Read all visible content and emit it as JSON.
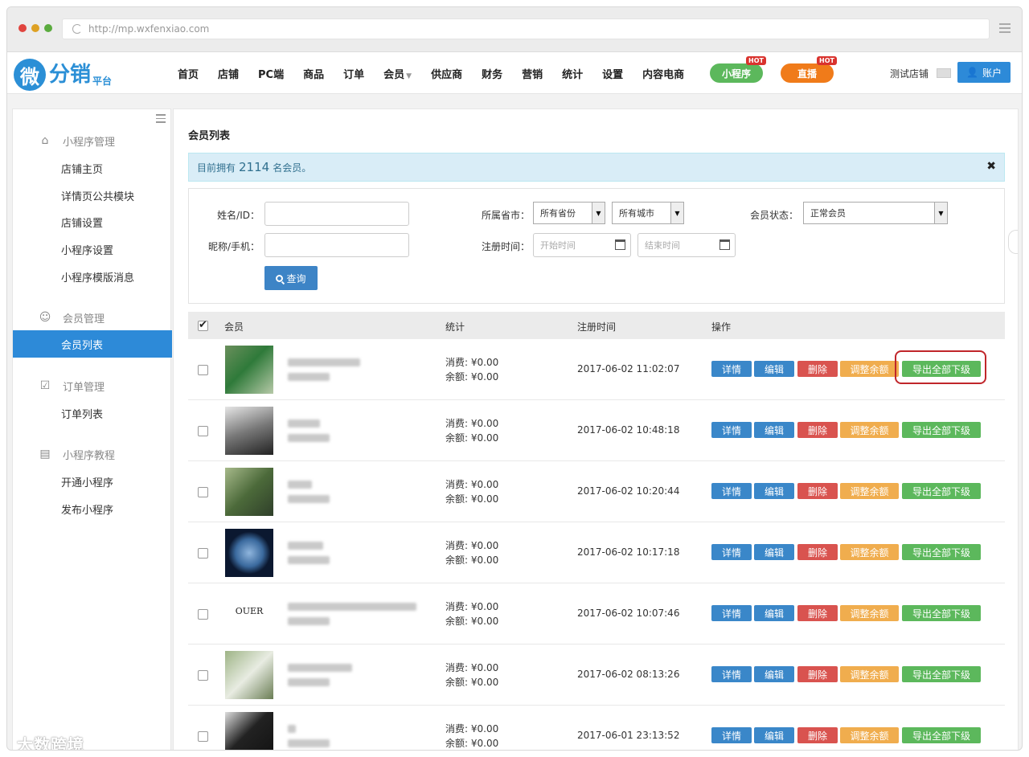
{
  "browser": {
    "url": "http://mp.wxfenxiao.com"
  },
  "brand": {
    "logo_char": "微",
    "logo_text": "分销",
    "logo_sub": "平台"
  },
  "nav": {
    "links": [
      "首页",
      "店铺",
      "PC端",
      "商品",
      "订单",
      "会员",
      "供应商",
      "财务",
      "营销",
      "统计",
      "设置",
      "内容电商"
    ],
    "mini_program": "小程序",
    "live": "直播",
    "hot": "HOT",
    "shop_name": "测试店铺",
    "account": "账户"
  },
  "sidebar": {
    "groups": [
      {
        "title": "小程序管理",
        "icon": "home-icon",
        "items": [
          "店铺主页",
          "详情页公共模块",
          "店铺设置",
          "小程序设置",
          "小程序模版消息"
        ]
      },
      {
        "title": "会员管理",
        "icon": "users-icon",
        "items": [
          "会员列表"
        ]
      },
      {
        "title": "订单管理",
        "icon": "clipboard-icon",
        "items": [
          "订单列表"
        ]
      },
      {
        "title": "小程序教程",
        "icon": "book-icon",
        "items": [
          "开通小程序",
          "发布小程序"
        ]
      }
    ],
    "active": "会员列表"
  },
  "page": {
    "title": "会员列表",
    "notice_prefix": "目前拥有",
    "member_count": "2114",
    "notice_suffix": "名会员。",
    "notice_close": "✖"
  },
  "filters": {
    "name_label": "姓名/ID：",
    "nick_label": "昵称/手机：",
    "region_label": "所属省市：",
    "province": "所有省份",
    "city": "所有城市",
    "reg_label": "注册时间：",
    "start_placeholder": "开始时间",
    "end_placeholder": "结束时间",
    "status_label": "会员状态：",
    "status": "正常会员",
    "query_button": "查询"
  },
  "table": {
    "headers": {
      "member": "会员",
      "stats": "统计",
      "reg_time": "注册时间",
      "actions": "操作"
    },
    "actions": {
      "detail": "详情",
      "edit": "编辑",
      "delete": "删除",
      "adjust": "调整余额",
      "export": "导出全部下级"
    },
    "rows": [
      {
        "consume": "消费: ¥0.00",
        "balance": "余额: ¥0.00",
        "time": "2017-06-02 11:02:07",
        "avatar": "green-dress-photo"
      },
      {
        "consume": "消费: ¥0.00",
        "balance": "余额: ¥0.00",
        "time": "2017-06-02 10:48:18",
        "avatar": "bw-photo"
      },
      {
        "consume": "消费: ¥0.00",
        "balance": "余额: ¥0.00",
        "time": "2017-06-02 10:20:44",
        "avatar": "outdoor-photo"
      },
      {
        "consume": "消费: ¥0.00",
        "balance": "余额: ¥0.00",
        "time": "2017-06-02 10:17:18",
        "avatar": "earth-photo"
      },
      {
        "consume": "消费: ¥0.00",
        "balance": "余额: ¥0.00",
        "time": "2017-06-02 10:07:46",
        "avatar": "ouer-logo",
        "logo_text": "OUER"
      },
      {
        "consume": "消费: ¥0.00",
        "balance": "余额: ¥0.00",
        "time": "2017-06-02 08:13:26",
        "avatar": "flower-photo"
      },
      {
        "consume": "消费: ¥0.00",
        "balance": "余额: ¥0.00",
        "time": "2017-06-01 23:13:52",
        "avatar": "portrait-photo"
      }
    ]
  },
  "watermark": "大数跨境",
  "colors": {
    "primary": "#2d8ad8",
    "danger": "#d9534f",
    "warning": "#f0ad4e",
    "success": "#5cb85c",
    "live": "#f07b1a",
    "mini": "#5cb85c"
  }
}
